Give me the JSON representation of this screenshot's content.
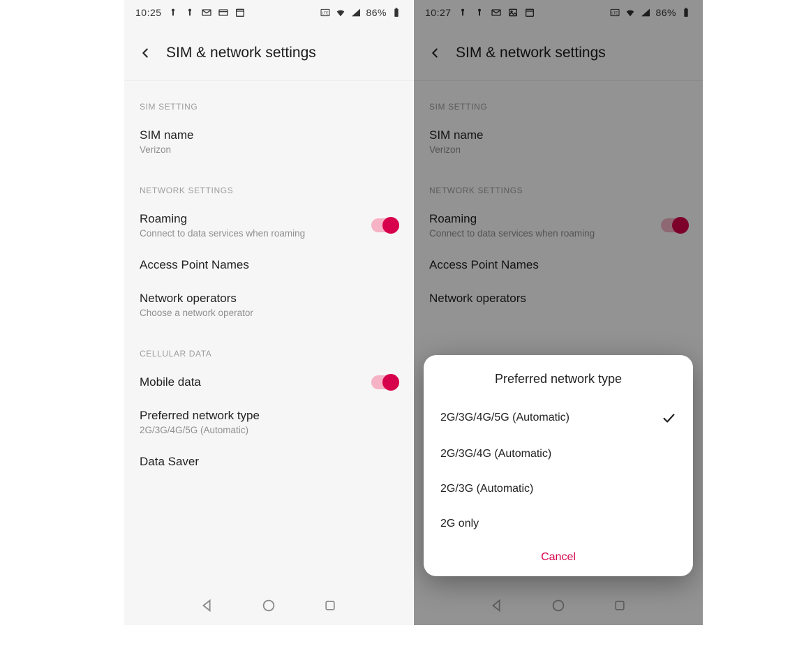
{
  "left": {
    "status": {
      "time": "10:25",
      "battery": "86%"
    },
    "title": "SIM & network settings",
    "sections": {
      "sim": {
        "label": "SIM SETTING",
        "name_title": "SIM name",
        "name_value": "Verizon"
      },
      "network": {
        "label": "NETWORK SETTINGS",
        "roaming_title": "Roaming",
        "roaming_sub": "Connect to data services when roaming",
        "apn_title": "Access Point Names",
        "ops_title": "Network operators",
        "ops_sub": "Choose a network operator"
      },
      "cellular": {
        "label": "CELLULAR DATA",
        "mobile_title": "Mobile data",
        "pref_title": "Preferred network type",
        "pref_sub": "2G/3G/4G/5G (Automatic)",
        "saver_title": "Data Saver"
      }
    }
  },
  "right": {
    "status": {
      "time": "10:27",
      "battery": "86%"
    },
    "title": "SIM & network settings",
    "sections": {
      "sim": {
        "label": "SIM SETTING",
        "name_title": "SIM name",
        "name_value": "Verizon"
      },
      "network": {
        "label": "NETWORK SETTINGS",
        "roaming_title": "Roaming",
        "roaming_sub": "Connect to data services when roaming",
        "apn_title": "Access Point Names",
        "ops_title": "Network operators"
      }
    },
    "dialog": {
      "title": "Preferred network type",
      "options": [
        "2G/3G/4G/5G (Automatic)",
        "2G/3G/4G (Automatic)",
        "2G/3G (Automatic)",
        "2G only"
      ],
      "selected_index": 0,
      "cancel": "Cancel"
    }
  }
}
